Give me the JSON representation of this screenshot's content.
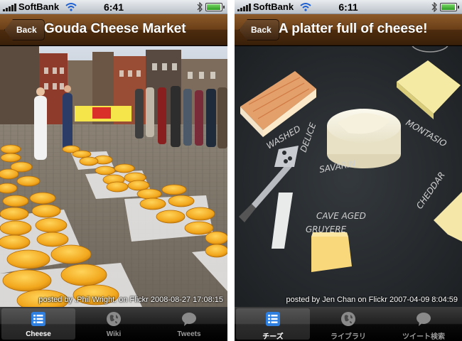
{
  "screens": [
    {
      "status": {
        "carrier": "SoftBank",
        "time": "6:41"
      },
      "nav": {
        "back_label": "Back",
        "title": "Gouda Cheese Market"
      },
      "photo": {
        "credit": "posted by .Phil Wright. on Flickr 2008-08-27 17:08:15"
      },
      "tabs": [
        {
          "label": "Cheese",
          "icon": "list-icon",
          "active": true
        },
        {
          "label": "Wiki",
          "icon": "globe-icon",
          "active": false
        },
        {
          "label": "Tweets",
          "icon": "speech-bubble-icon",
          "active": false
        }
      ]
    },
    {
      "status": {
        "carrier": "SoftBank",
        "time": "6:11"
      },
      "nav": {
        "back_label": "Back",
        "title": "A platter full of cheese!"
      },
      "photo": {
        "credit": "posted by Jen Chan on Flickr 2007-04-09 8:04:59",
        "chalk_labels": [
          "CAVE AGED",
          "GRUYERE",
          "SAVARIN",
          "CHEDDAR",
          "DELICE",
          "WASHED",
          "MONTASIO"
        ]
      },
      "tabs": [
        {
          "label": "チーズ",
          "icon": "list-icon",
          "active": true
        },
        {
          "label": "ライブラリ",
          "icon": "globe-icon",
          "active": false
        },
        {
          "label": "ツイート検索",
          "icon": "speech-bubble-icon",
          "active": false
        }
      ]
    }
  ],
  "colors": {
    "nav_bar": "#6b3f17",
    "tab_bar": "#000000",
    "active_tab_icon": "#2f7fe0"
  }
}
